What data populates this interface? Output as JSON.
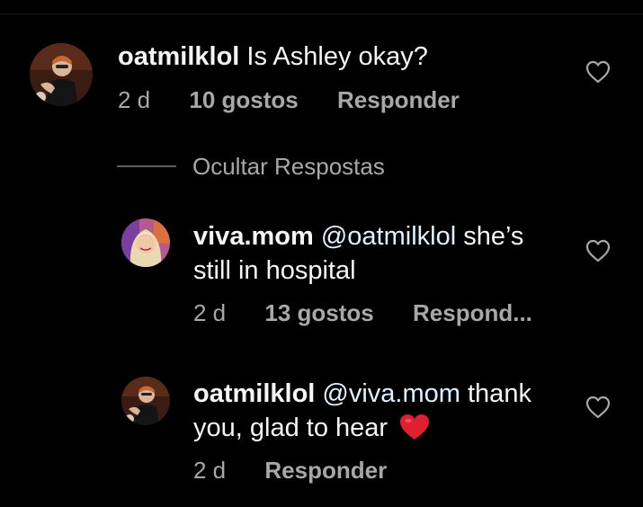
{
  "comments": [
    {
      "username": "oatmilklol",
      "text": "Is Ashley okay?",
      "time": "2 d",
      "likes": "10 gostos",
      "reply_label": "Responder"
    }
  ],
  "hide_replies_label": "Ocultar Respostas",
  "replies": [
    {
      "username": "viva.mom",
      "mention": "@oatmilklol",
      "text_line1": "she’s",
      "text_line2": "still in hospital",
      "time": "2 d",
      "likes": "13 gostos",
      "reply_label": "Respond..."
    },
    {
      "username": "oatmilklol",
      "mention": "@viva.mom",
      "text_line1": "thank",
      "text_line2": "you, glad to hear",
      "emoji_icon": "red-heart-emoji",
      "time": "2 d",
      "reply_label": "Responder"
    }
  ],
  "icons": {
    "like": "heart-outline-icon"
  },
  "colors": {
    "background": "#000000",
    "text": "#f5f5f5",
    "secondary": "#a8a8a8",
    "mention": "#e0f1ff",
    "emoji_heart": "#e0202e"
  }
}
